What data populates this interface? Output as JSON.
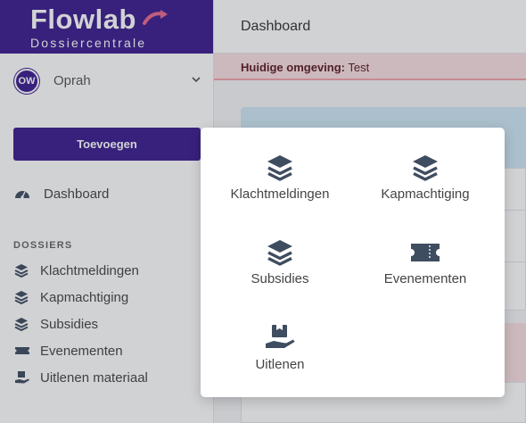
{
  "app": {
    "logo_main": "Flowlab",
    "logo_sub": "Dossiercentrale"
  },
  "user": {
    "initials": "OW",
    "name": "Oprah"
  },
  "sidebar": {
    "add_button": "Toevoegen",
    "dashboard": "Dashboard",
    "section_title": "DOSSIERS",
    "items": [
      {
        "label": "Klachtmeldingen",
        "icon": "layers-icon"
      },
      {
        "label": "Kapmachtiging",
        "icon": "layers-icon"
      },
      {
        "label": "Subsidies",
        "icon": "layers-icon"
      },
      {
        "label": "Evenementen",
        "icon": "ticket-icon"
      },
      {
        "label": "Uitlenen materiaal",
        "icon": "hand-box-icon"
      }
    ]
  },
  "header": {
    "title": "Dashboard"
  },
  "environment": {
    "label": "Huidige omgeving:",
    "value": "Test"
  },
  "popup": {
    "tiles": [
      {
        "label": "Klachtmeldingen",
        "icon": "layers-icon"
      },
      {
        "label": "Kapmachtiging",
        "icon": "layers-icon"
      },
      {
        "label": "Subsidies",
        "icon": "layers-icon"
      },
      {
        "label": "Evenementen",
        "icon": "ticket-icon"
      },
      {
        "label": "Uitlenen",
        "icon": "hand-box-icon"
      }
    ]
  },
  "colors": {
    "brand": "#3b1d8f",
    "env_banner": "#f9dfe2",
    "icon": "#3f4d60"
  }
}
